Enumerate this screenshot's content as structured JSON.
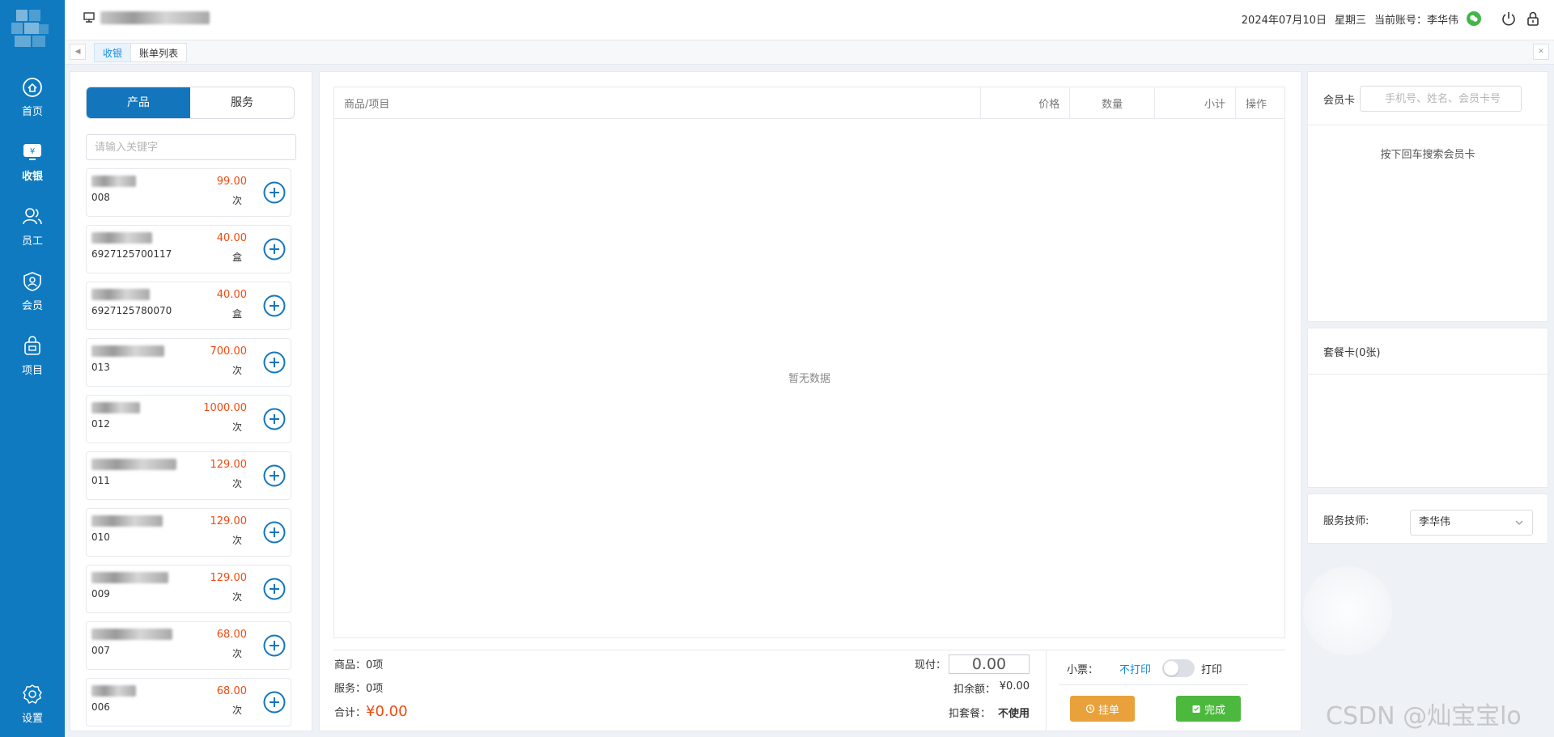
{
  "header": {
    "date": "2024年07月10日",
    "weekday": "星期三",
    "account_label": "当前账号：",
    "account_name": "李华伟"
  },
  "nav": {
    "items": [
      {
        "label": "首页",
        "icon": "home-icon"
      },
      {
        "label": "收银",
        "icon": "cashier-icon"
      },
      {
        "label": "员工",
        "icon": "staff-icon"
      },
      {
        "label": "会员",
        "icon": "member-icon"
      },
      {
        "label": "项目",
        "icon": "project-icon"
      }
    ],
    "settings": "设置"
  },
  "tabs": [
    {
      "label": "收银",
      "active": true
    },
    {
      "label": "账单列表",
      "active": false
    }
  ],
  "left": {
    "segments": [
      "产品",
      "服务"
    ],
    "keyword_placeholder": "请输入关键字",
    "products": [
      {
        "code": "008",
        "price": "99.00",
        "unit": "次"
      },
      {
        "code": "6927125700117",
        "price": "40.00",
        "unit": "盒"
      },
      {
        "code": "6927125780070",
        "price": "40.00",
        "unit": "盒"
      },
      {
        "code": "013",
        "price": "700.00",
        "unit": "次"
      },
      {
        "code": "012",
        "price": "1000.00",
        "unit": "次"
      },
      {
        "code": "011",
        "price": "129.00",
        "unit": "次"
      },
      {
        "code": "010",
        "price": "129.00",
        "unit": "次"
      },
      {
        "code": "009",
        "price": "129.00",
        "unit": "次"
      },
      {
        "code": "007",
        "price": "68.00",
        "unit": "次"
      },
      {
        "code": "006",
        "price": "68.00",
        "unit": "次"
      }
    ]
  },
  "table": {
    "columns": [
      "商品/项目",
      "价格",
      "数量",
      "小计",
      "操作"
    ],
    "empty": "暂无数据"
  },
  "summary": {
    "goods_label": "商品：",
    "goods_value": "0项",
    "service_label": "服务：",
    "service_value": "0项",
    "total_label": "合计：",
    "total_value": "¥0.00",
    "cash_label": "现付：",
    "cash_value": "0.00",
    "balance_label": "扣余额：",
    "balance_value": "¥0.00",
    "package_label": "扣套餐：",
    "package_value": "不使用",
    "receipt_label": "小票：",
    "no_print": "不打印",
    "print": "打印",
    "hold_button": "挂单",
    "done_button": "完成"
  },
  "right": {
    "member_card_label": "会员卡",
    "search_placeholder": "手机号、姓名、会员卡号",
    "search_hint": "按下回车搜索会员卡",
    "package_card_label": "套餐卡(0张)",
    "technician_label": "服务技师:",
    "technician_value": "李华伟"
  },
  "watermark": "CSDN @灿宝宝lo",
  "colors": {
    "brand": "#0f7ac0",
    "price": "#f04b10",
    "hold": "#e9a23b",
    "done": "#4cb93e"
  }
}
